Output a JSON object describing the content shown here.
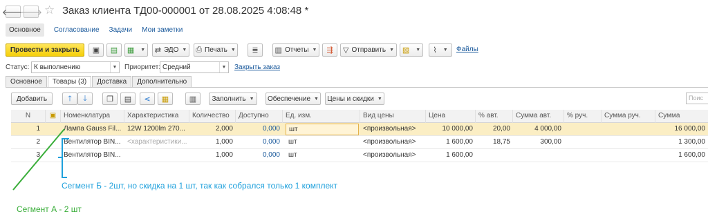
{
  "window": {
    "title": "Заказ клиента ТД00-000001 от 28.08.2025 4:08:48 *",
    "back_glyph": "🡐",
    "forward_glyph": "🡒",
    "star_glyph": "☆"
  },
  "subnav": [
    "Основное",
    "Согласование",
    "Задачи",
    "Мои заметки"
  ],
  "toolbar": {
    "post_close": "Провести и закрыть",
    "edo": "ЭДО",
    "print": "Печать",
    "reports": "Отчеты",
    "send": "Отправить",
    "files": "Файлы"
  },
  "status_row": {
    "status_label": "Статус:",
    "status_value": "К выполнению",
    "priority_label": "Приоритет:",
    "priority_value": "Средний",
    "close_link": "Закрыть заказ"
  },
  "tabs": [
    "Основное",
    "Товары (3)",
    "Доставка",
    "Дополнительно"
  ],
  "table_toolbar": {
    "add": "Добавить",
    "fill": "Заполнить",
    "supply": "Обеспечение",
    "prices": "Цены и скидки",
    "search_placeholder": "Поис"
  },
  "grid": {
    "headers": [
      "N",
      "Номенклатура",
      "Характеристика",
      "Количество",
      "Доступно",
      "Ед. изм.",
      "Вид цены",
      "Цена",
      "% авт.",
      "Сумма авт.",
      "% руч.",
      "Сумма руч.",
      "Сумма"
    ],
    "rows": [
      {
        "n": "1",
        "item": "Лампа Gauss Fil...",
        "char": "12W 1200lm 270...",
        "qty": "2,000",
        "avail": "0,000",
        "unit": "шт",
        "price_type": "<произвольная>",
        "price": "10 000,00",
        "pct_auto": "20,00",
        "sum_auto": "4 000,00",
        "pct_manual": "",
        "sum_manual": "",
        "sum": "16 000,00"
      },
      {
        "n": "2",
        "item": "Вентилятор BIN...",
        "char": "<характеристики...",
        "qty": "1,000",
        "avail": "0,000",
        "unit": "шт",
        "price_type": "<произвольная>",
        "price": "1 600,00",
        "pct_auto": "18,75",
        "sum_auto": "300,00",
        "pct_manual": "",
        "sum_manual": "",
        "sum": "1 300,00"
      },
      {
        "n": "3",
        "item": "Вентилятор BIN...",
        "char": "",
        "qty": "1,000",
        "avail": "0,000",
        "unit": "шт",
        "price_type": "<произвольная>",
        "price": "1 600,00",
        "pct_auto": "",
        "sum_auto": "",
        "pct_manual": "",
        "sum_manual": "",
        "sum": "1 600,00"
      }
    ]
  },
  "annotations": {
    "segment_b": "Сегмент Б - 2шт, но скидка на 1 шт, так как собрался только 1 комплект",
    "segment_a": "Сегмент А - 2 шт",
    "color_b": "#1ea0dc",
    "color_a": "#3aae3a"
  },
  "colors": {
    "primary_button": "#f5cf0a",
    "link": "#1b5a9c",
    "selected_row": "#fbeec4"
  }
}
